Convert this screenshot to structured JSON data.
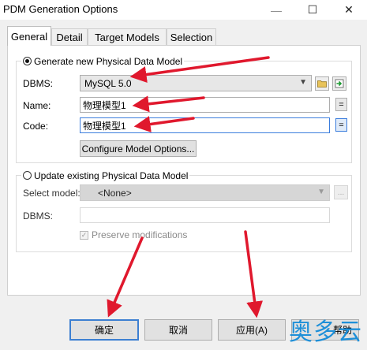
{
  "window": {
    "title": "PDM Generation Options",
    "minimize_glyph": "—",
    "maximize_glyph": "☐",
    "close_glyph": "✕"
  },
  "tabs": [
    {
      "label": "General",
      "active": true
    },
    {
      "label": "Detail"
    },
    {
      "label": "Target Models"
    },
    {
      "label": "Selection"
    }
  ],
  "generate_group": {
    "radio_label": "Generate new Physical Data Model",
    "dbms_label": "DBMS:",
    "dbms_value": "MySQL 5.0",
    "name_label": "Name:",
    "name_value": "物理模型1",
    "code_label": "Code:",
    "code_value": "物理模型1",
    "eq_label": "=",
    "configure_label": "Configure Model Options..."
  },
  "update_group": {
    "radio_label": "Update existing Physical Data Model",
    "select_model_label": "Select model:",
    "select_model_value": "<None>",
    "browse_label": "...",
    "dbms_label": "DBMS:",
    "dbms_value": "",
    "preserve_label": "Preserve modifications",
    "check_glyph": "✓"
  },
  "footer": {
    "ok_label": "确定",
    "cancel_label": "取消",
    "apply_label": "应用(A)",
    "help_label": "帮助"
  },
  "watermark": "奥多云",
  "colors": {
    "annotation_arrow": "#e0182d",
    "focus_border": "#3b7ddd",
    "watermark": "#1e8fd8"
  },
  "icons": {
    "open_folder": "folder-open-icon",
    "attach": "green-arrow-icon"
  }
}
